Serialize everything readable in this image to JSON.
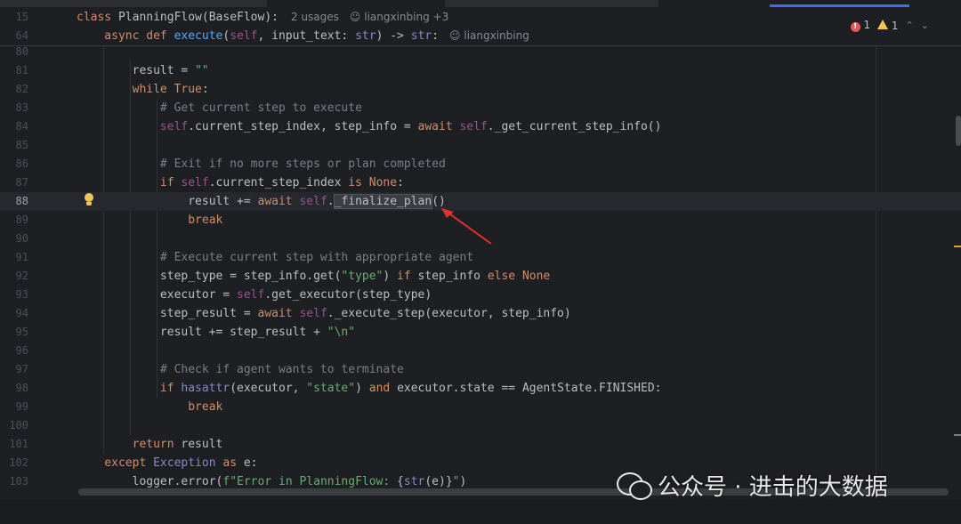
{
  "colors": {
    "background": "#1e1f22",
    "keyword": "#cf8e6d",
    "self": "#94558d",
    "function": "#56a8f5",
    "string": "#6aab73",
    "comment": "#7a7e85",
    "builtin": "#8888c6",
    "text": "#bcbec4",
    "arrow": "#e0312f"
  },
  "sticky": [
    {
      "line": "15",
      "tokens": [
        {
          "c": "kw",
          "t": "class "
        },
        {
          "c": "cls",
          "t": "PlanningFlow(BaseFlow):"
        }
      ],
      "hint": "2 usages",
      "author": "liangxinbing +3"
    },
    {
      "line": "64",
      "tokens": [
        {
          "c": "kw",
          "t": "    async def "
        },
        {
          "c": "fn",
          "t": "execute"
        },
        {
          "c": "cls",
          "t": "("
        },
        {
          "c": "self",
          "t": "self"
        },
        {
          "c": "cls",
          "t": ", input_text: "
        },
        {
          "c": "blt",
          "t": "str"
        },
        {
          "c": "cls",
          "t": ") -> "
        },
        {
          "c": "blt",
          "t": "str"
        },
        {
          "c": "cls",
          "t": ":"
        }
      ],
      "author": "liangxinbing"
    }
  ],
  "status": {
    "errors": "1",
    "warnings": "1"
  },
  "lines": [
    {
      "n": "80",
      "tokens": []
    },
    {
      "n": "81",
      "tokens": [
        {
          "c": "cls",
          "t": "        result = "
        },
        {
          "c": "str",
          "t": "\"\""
        }
      ]
    },
    {
      "n": "82",
      "tokens": [
        {
          "c": "kw",
          "t": "        while "
        },
        {
          "c": "kw",
          "t": "True"
        },
        {
          "c": "cls",
          "t": ":"
        }
      ]
    },
    {
      "n": "83",
      "tokens": [
        {
          "c": "cmt",
          "t": "            # Get current step to execute"
        }
      ]
    },
    {
      "n": "84",
      "tokens": [
        {
          "c": "self",
          "t": "            self"
        },
        {
          "c": "cls",
          "t": ".current_step_index, step_info = "
        },
        {
          "c": "kw",
          "t": "await "
        },
        {
          "c": "self",
          "t": "self"
        },
        {
          "c": "cls",
          "t": "._get_current_step_info()"
        }
      ]
    },
    {
      "n": "85",
      "tokens": []
    },
    {
      "n": "86",
      "tokens": [
        {
          "c": "cmt",
          "t": "            # Exit if no more steps or plan completed"
        }
      ]
    },
    {
      "n": "87",
      "tokens": [
        {
          "c": "kw",
          "t": "            if "
        },
        {
          "c": "self",
          "t": "self"
        },
        {
          "c": "cls",
          "t": ".current_step_index "
        },
        {
          "c": "kw",
          "t": "is None"
        },
        {
          "c": "cls",
          "t": ":"
        }
      ]
    },
    {
      "n": "88",
      "current": true,
      "tokens": [
        {
          "c": "cls",
          "t": "                result += "
        },
        {
          "c": "kw",
          "t": "await "
        },
        {
          "c": "self",
          "t": "self"
        },
        {
          "c": "cls",
          "t": "."
        },
        {
          "c": "hl",
          "t": "_finalize_plan"
        },
        {
          "c": "cls",
          "t": "()"
        }
      ]
    },
    {
      "n": "89",
      "tokens": [
        {
          "c": "kw",
          "t": "                break"
        }
      ]
    },
    {
      "n": "90",
      "tokens": []
    },
    {
      "n": "91",
      "tokens": [
        {
          "c": "cmt",
          "t": "            # Execute current step with appropriate agent"
        }
      ]
    },
    {
      "n": "92",
      "tokens": [
        {
          "c": "cls",
          "t": "            step_type = step_info.get("
        },
        {
          "c": "str",
          "t": "\"type\""
        },
        {
          "c": "cls",
          "t": ") "
        },
        {
          "c": "kw",
          "t": "if "
        },
        {
          "c": "cls",
          "t": "step_info "
        },
        {
          "c": "kw",
          "t": "else None"
        }
      ]
    },
    {
      "n": "93",
      "tokens": [
        {
          "c": "cls",
          "t": "            executor = "
        },
        {
          "c": "self",
          "t": "self"
        },
        {
          "c": "cls",
          "t": ".get_executor(step_type)"
        }
      ]
    },
    {
      "n": "94",
      "tokens": [
        {
          "c": "cls",
          "t": "            step_result = "
        },
        {
          "c": "kw",
          "t": "await "
        },
        {
          "c": "self",
          "t": "self"
        },
        {
          "c": "cls",
          "t": "._execute_step(executor, step_info)"
        }
      ]
    },
    {
      "n": "95",
      "tokens": [
        {
          "c": "cls",
          "t": "            result += step_result + "
        },
        {
          "c": "str",
          "t": "\"\\n\""
        }
      ]
    },
    {
      "n": "96",
      "tokens": []
    },
    {
      "n": "97",
      "tokens": [
        {
          "c": "cmt",
          "t": "            # Check if agent wants to terminate"
        }
      ]
    },
    {
      "n": "98",
      "tokens": [
        {
          "c": "kw",
          "t": "            if "
        },
        {
          "c": "blt",
          "t": "hasattr"
        },
        {
          "c": "cls",
          "t": "(executor, "
        },
        {
          "c": "str",
          "t": "\"state\""
        },
        {
          "c": "cls",
          "t": ") "
        },
        {
          "c": "kw",
          "t": "and "
        },
        {
          "c": "cls",
          "t": "executor.state == AgentState.FINISHED:"
        }
      ]
    },
    {
      "n": "99",
      "tokens": [
        {
          "c": "kw",
          "t": "                break"
        }
      ]
    },
    {
      "n": "100",
      "tokens": []
    },
    {
      "n": "101",
      "tokens": [
        {
          "c": "kw",
          "t": "        return "
        },
        {
          "c": "cls",
          "t": "result"
        }
      ]
    },
    {
      "n": "102",
      "tokens": [
        {
          "c": "kw",
          "t": "    except "
        },
        {
          "c": "blt",
          "t": "Exception "
        },
        {
          "c": "kw",
          "t": "as "
        },
        {
          "c": "cls",
          "t": "e:"
        }
      ]
    },
    {
      "n": "103",
      "tokens": [
        {
          "c": "cls",
          "t": "        logger.error("
        },
        {
          "c": "str",
          "t": "f\"Error in PlanningFlow: "
        },
        {
          "c": "cls",
          "t": "{"
        },
        {
          "c": "blt",
          "t": "str"
        },
        {
          "c": "cls",
          "t": "(e)}"
        },
        {
          "c": "str",
          "t": "\""
        },
        {
          "c": "cls",
          "t": ")"
        }
      ]
    }
  ],
  "watermark": {
    "text": "公众号 · 进击的大数据",
    "icon": "wechat-icon"
  }
}
